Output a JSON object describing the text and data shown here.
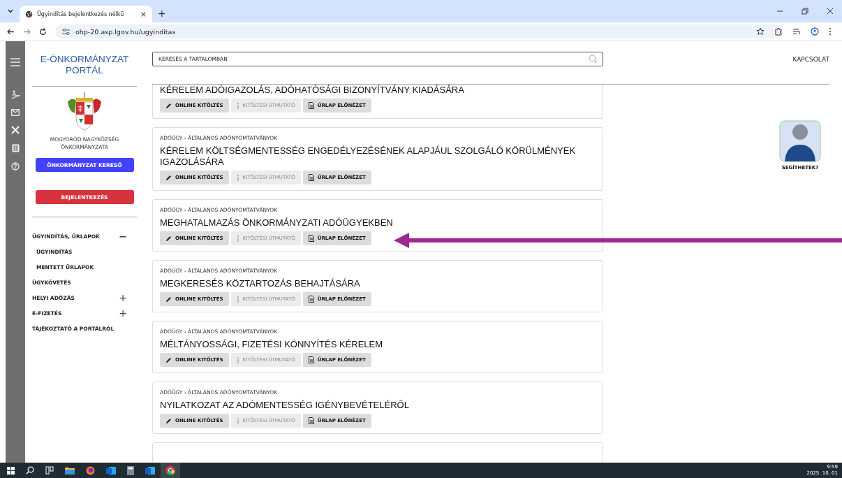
{
  "browser": {
    "tab_title": "Ügyindítás bejelentkezés nélkü",
    "close_tab": "×",
    "new_tab": "+",
    "url": "ohp-20.asp.lgov.hu/ugyinditas"
  },
  "sidebar": {
    "portal_title": "E-ÖNKORMÁNYZAT PORTÁL",
    "municipality": "MOGYORÓD NAGYKÖZSÉG ÖNKORMÁNYZATA",
    "search_button": "ÖNKORMÁNYZAT KERESŐ",
    "login_button": "BEJELENTKEZÉS",
    "items": [
      {
        "label": "ÜGYINDÍTÁS, ŰRLAPOK",
        "toggle": "−",
        "expanded": true,
        "children": [
          {
            "label": "ÜGYINDÍTÁS"
          },
          {
            "label": "MENTETT ŰRLAPOK"
          }
        ]
      },
      {
        "label": "ÜGYKÖVETÉS"
      },
      {
        "label": "HELYI ADÓZÁS",
        "toggle": "+",
        "expanded": false
      },
      {
        "label": "E-FIZETÉS",
        "toggle": "+",
        "expanded": false
      },
      {
        "label": "TÁJÉKOZTATÓ A PORTÁLRÓL"
      }
    ]
  },
  "search": {
    "placeholder": "KERESÉS A TARTALOMBAN"
  },
  "contact_link": "KAPCSOLAT",
  "helper": {
    "label": "SEGÍTHETEK?"
  },
  "forms": [
    {
      "title": "KÉRELEM ADÓIGAZOLÁS, ADÓHATÓSÁGI BIZONYÍTVÁNY KIADÁSÁRA",
      "buttons": [
        {
          "kind": "edit",
          "label": "ONLINE KITÖLTÉS",
          "disabled": false
        },
        {
          "kind": "info",
          "label": "KITÖLTÉSI ÚTMUTATÓ",
          "disabled": true
        },
        {
          "kind": "preview",
          "label": "ŰRLAP ELŐNÉZET",
          "disabled": false
        }
      ]
    },
    {
      "breadcrumb": "ADÓÜGY › ÁLTALÁNOS ADÓNYOMTATVÁNYOK",
      "title": "KÉRELEM KÖLTSÉGMENTESSÉG ENGEDÉLYEZÉSÉNEK ALAPJÁUL SZOLGÁLÓ KÖRÜLMÉNYEK IGAZOLÁSÁRA",
      "buttons": [
        {
          "kind": "edit",
          "label": "ONLINE KITÖLTÉS",
          "disabled": false
        },
        {
          "kind": "info",
          "label": "KITÖLTÉSI ÚTMUTATÓ",
          "disabled": true
        },
        {
          "kind": "preview",
          "label": "ŰRLAP ELŐNÉZET",
          "disabled": false
        }
      ]
    },
    {
      "breadcrumb": "ADÓÜGY › ÁLTALÁNOS ADÓNYOMTATVÁNYOK",
      "title": "MEGHATALMAZÁS ÖNKORMÁNYZATI ADÓÜGYEKBEN",
      "buttons": [
        {
          "kind": "edit",
          "label": "ONLINE KITÖLTÉS",
          "disabled": false
        },
        {
          "kind": "info",
          "label": "KITÖLTÉSI ÚTMUTATÓ",
          "disabled": true
        },
        {
          "kind": "preview",
          "label": "ŰRLAP ELŐNÉZET",
          "disabled": false
        }
      ]
    },
    {
      "breadcrumb": "ADÓÜGY › ÁLTALÁNOS ADÓNYOMTATVÁNYOK",
      "title": "MEGKERESÉS KÖZTARTOZÁS BEHAJTÁSÁRA",
      "buttons": [
        {
          "kind": "edit",
          "label": "ONLINE KITÖLTÉS",
          "disabled": false
        },
        {
          "kind": "info",
          "label": "KITÖLTÉSI ÚTMUTATÓ",
          "disabled": true
        },
        {
          "kind": "preview",
          "label": "ŰRLAP ELŐNÉZET",
          "disabled": false
        }
      ]
    },
    {
      "breadcrumb": "ADÓÜGY › ÁLTALÁNOS ADÓNYOMTATVÁNYOK",
      "title": "MÉLTÁNYOSSÁGI, FIZETÉSI KÖNNYÍTÉS KÉRELEM",
      "buttons": [
        {
          "kind": "edit",
          "label": "ONLINE KITÖLTÉS",
          "disabled": false
        },
        {
          "kind": "info",
          "label": "KITÖLTÉSI ÚTMUTATÓ",
          "disabled": true
        },
        {
          "kind": "preview",
          "label": "ŰRLAP ELŐNÉZET",
          "disabled": false
        }
      ]
    },
    {
      "breadcrumb": "ADÓÜGY › ÁLTALÁNOS ADÓNYOMTATVÁNYOK",
      "title": "NYILATKOZAT AZ ADÓMENTESSÉG IGÉNYBEVÉTELÉRŐL",
      "buttons": [
        {
          "kind": "edit",
          "label": "ONLINE KITÖLTÉS",
          "disabled": false
        },
        {
          "kind": "info",
          "label": "KITÖLTÉSI ÚTMUTATÓ",
          "disabled": true
        },
        {
          "kind": "preview",
          "label": "ŰRLAP ELŐNÉZET",
          "disabled": false
        }
      ]
    }
  ],
  "taskbar": {
    "time": "9:59",
    "date": "2025. 10. 01"
  }
}
